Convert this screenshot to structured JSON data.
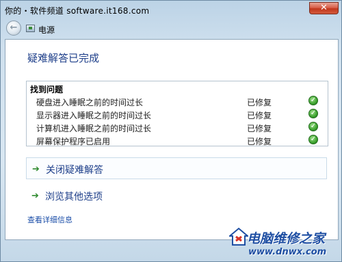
{
  "watermark_top": "你的・软件频道 software.it168.com",
  "window": {
    "close_label": "✕",
    "breadcrumb": "电源"
  },
  "pane": {
    "title": "疑难解答已完成",
    "problems_header": "找到问题",
    "problems": [
      {
        "label": "硬盘进入睡眠之前的时间过长",
        "status": "已修复"
      },
      {
        "label": "显示器进入睡眠之前的时间过长",
        "status": "已修复"
      },
      {
        "label": "计算机进入睡眠之前的时间过长",
        "status": "已修复"
      },
      {
        "label": "屏幕保护程序已启用",
        "status": "已修复"
      }
    ],
    "commands": [
      {
        "label": "关闭疑难解答"
      },
      {
        "label": "浏览其他选项"
      }
    ],
    "details_link": "查看详细信息"
  },
  "logo": {
    "name": "电脑维修之家",
    "url": "www.dnwx.com"
  },
  "colors": {
    "title_blue": "#1e3f8a",
    "link_blue": "#1b4ea8",
    "check_green": "#3da22f"
  }
}
